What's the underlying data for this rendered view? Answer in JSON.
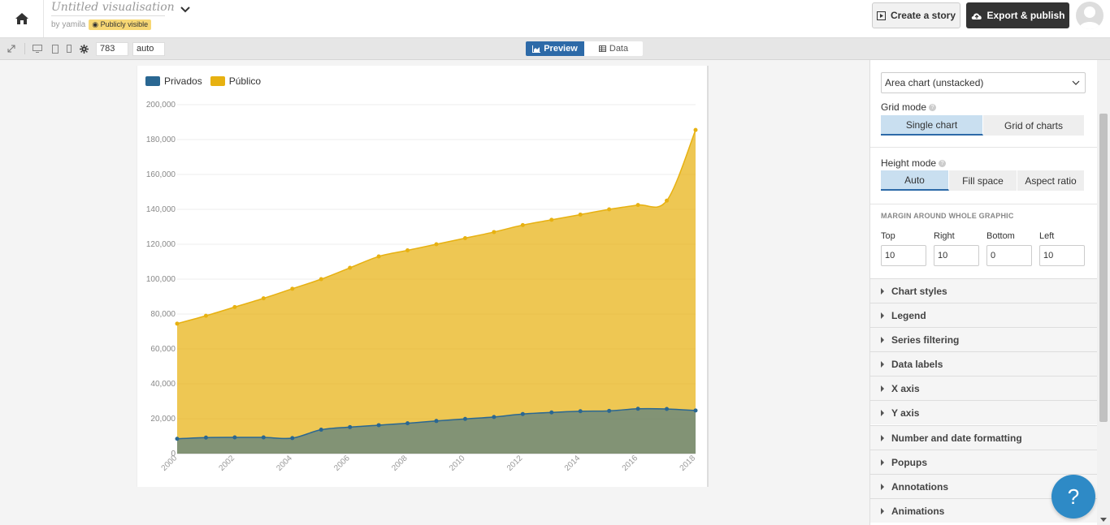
{
  "header": {
    "title": "Untitled visualisation",
    "byline": "by yamila",
    "visibility": "Publicly visible",
    "create_story_label": "Create a story",
    "export_label": "Export & publish"
  },
  "toolbar": {
    "width_value": "783",
    "height_value": "auto",
    "preview_label": "Preview",
    "data_label": "Data"
  },
  "colors": {
    "privados": "#2a6792",
    "publico": "#e7b111",
    "accent": "#2d6aa8"
  },
  "chart_data": {
    "type": "area",
    "title": "",
    "xlabel": "",
    "ylabel": "",
    "x": [
      2000,
      2001,
      2002,
      2003,
      2004,
      2005,
      2006,
      2007,
      2008,
      2009,
      2010,
      2011,
      2012,
      2013,
      2014,
      2015,
      2016,
      2017,
      2018
    ],
    "x_ticks": [
      "2000",
      "2002",
      "2004",
      "2006",
      "2008",
      "2010",
      "2012",
      "2014",
      "2016",
      "2018"
    ],
    "y_ticks": [
      "0",
      "20,000",
      "40,000",
      "60,000",
      "80,000",
      "100,000",
      "120,000",
      "140,000",
      "160,000",
      "180,000",
      "200,000"
    ],
    "ylim": [
      0,
      200000
    ],
    "legend_position": "top-left",
    "grid": true,
    "stacked": false,
    "series": [
      {
        "name": "Privados",
        "values": [
          8500,
          9200,
          9300,
          9300,
          8900,
          13700,
          15200,
          16300,
          17400,
          18700,
          19900,
          21000,
          22700,
          23600,
          24300,
          24500,
          25700,
          25600,
          24700
        ]
      },
      {
        "name": "Público",
        "values": [
          74500,
          79000,
          84000,
          89000,
          94500,
          100000,
          106500,
          113000,
          116500,
          120000,
          123500,
          127000,
          131000,
          134000,
          137000,
          140000,
          142500,
          145000,
          185500
        ]
      }
    ]
  },
  "panel": {
    "chart_type": "Area chart (unstacked)",
    "grid_mode_label": "Grid mode",
    "grid_mode_options": [
      "Single chart",
      "Grid of charts"
    ],
    "height_mode_label": "Height mode",
    "height_mode_options": [
      "Auto",
      "Fill space",
      "Aspect ratio"
    ],
    "margin_heading": "MARGIN AROUND WHOLE GRAPHIC",
    "margin_labels": [
      "Top",
      "Right",
      "Bottom",
      "Left"
    ],
    "margin_values": [
      "10",
      "10",
      "0",
      "10"
    ],
    "sections": [
      "Chart styles",
      "Legend",
      "Series filtering",
      "Data labels",
      "X axis",
      "Y axis",
      "Number and date formatting",
      "Popups",
      "Annotations",
      "Animations"
    ]
  },
  "help_label": "?"
}
